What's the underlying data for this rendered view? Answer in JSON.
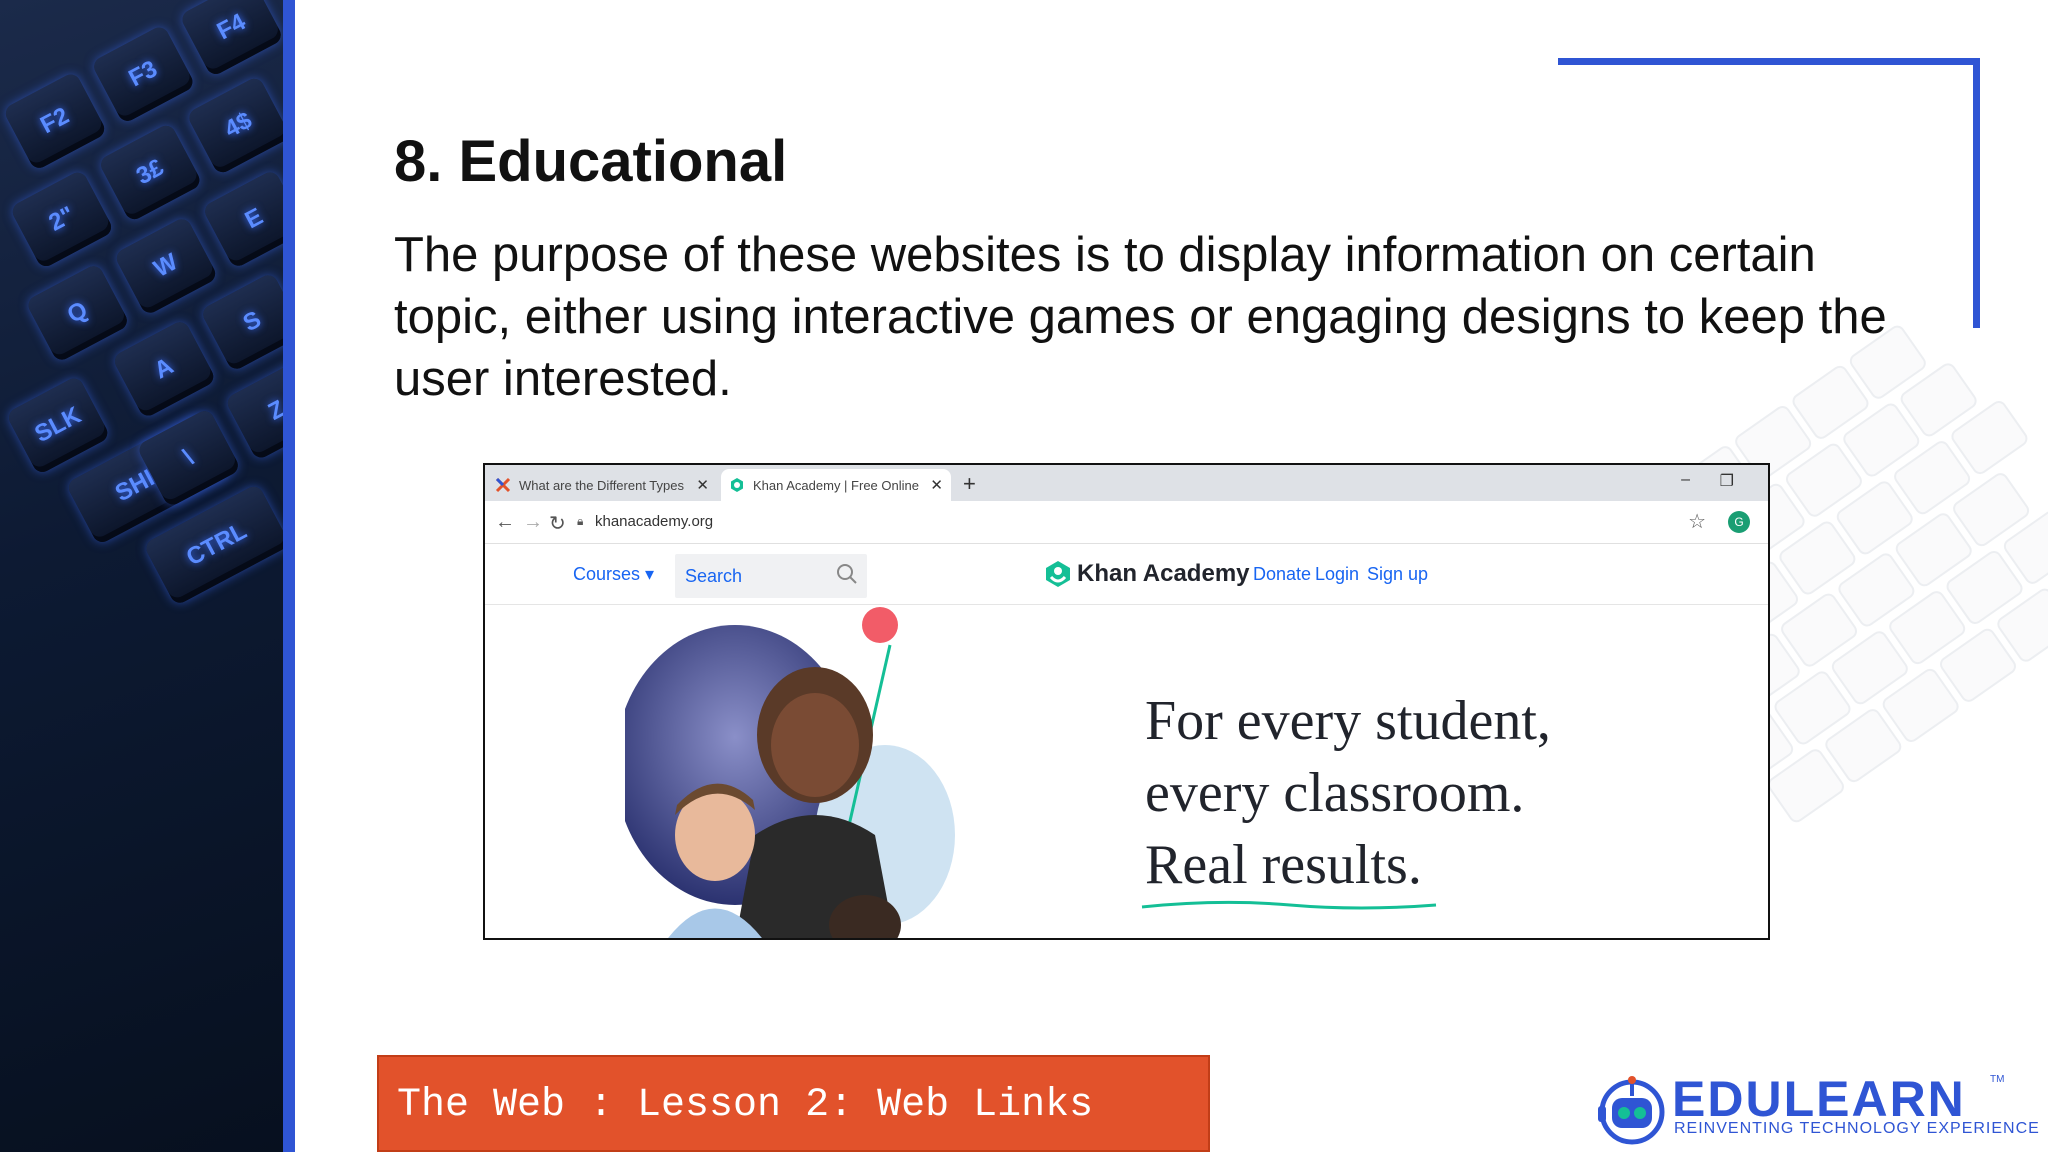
{
  "slide": {
    "heading": "8. Educational",
    "body": "The purpose of these websites is to display information on certain topic, either using interactive games or engaging designs to keep the user interested."
  },
  "keyboard_keys": [
    "F2",
    "F3",
    "F4",
    "2\"",
    "3£",
    "4$",
    "W",
    "E",
    "Q",
    "A",
    "S",
    "Z",
    "SLK",
    "SHIFT",
    "CTRL",
    "\\"
  ],
  "browser": {
    "tabs": [
      {
        "title": "What are the Different Types of",
        "icon": "x-favicon-icon"
      },
      {
        "title": "Khan Academy | Free Online Cou",
        "icon": "khan-favicon-icon"
      }
    ],
    "url": "khanacademy.org",
    "avatar_letter": "G"
  },
  "site": {
    "nav_courses": "Courses ▾",
    "search_label": "Search",
    "logo_text": "Khan Academy",
    "donate": "Donate",
    "login": "Login",
    "signup": "Sign up",
    "tagline": [
      "For every student,",
      "every classroom.",
      "Real results."
    ]
  },
  "footer": {
    "text": "The Web : Lesson 2: Web Links"
  },
  "brand": {
    "name": "EDULEARN",
    "tagline": "REINVENTING TECHNOLOGY EXPERIENCE",
    "tm": "TM"
  },
  "colors": {
    "accent_blue": "#2f55d4",
    "footer_orange": "#e2522b",
    "khan_blue": "#1865f2",
    "khan_green": "#14bf96"
  }
}
